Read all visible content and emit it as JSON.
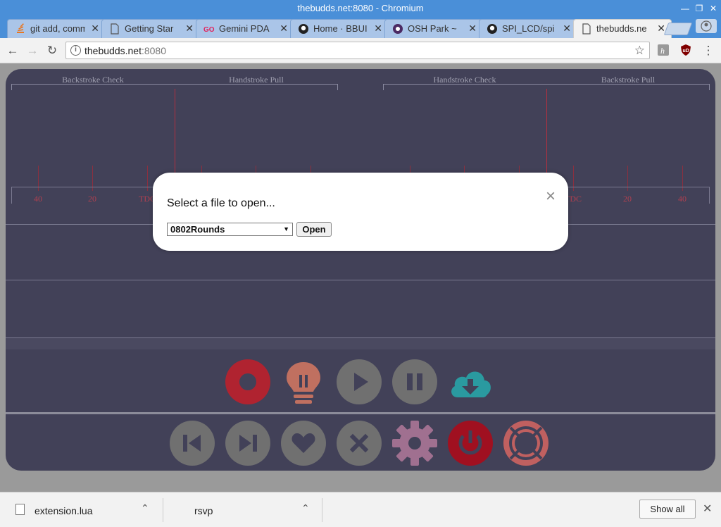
{
  "window": {
    "title": "thebudds.net:8080 - Chromium"
  },
  "tabs": [
    {
      "title": "git add, comm",
      "icon": "stackoverflow-icon"
    },
    {
      "title": "Getting Star",
      "icon": "document-icon"
    },
    {
      "title": "Gemini PDA",
      "icon": "go-icon"
    },
    {
      "title": "Home · BBUI",
      "icon": "github-icon"
    },
    {
      "title": "OSH Park ~",
      "icon": "oshpark-icon"
    },
    {
      "title": "SPI_LCD/spi",
      "icon": "github-icon"
    },
    {
      "title": "thebudds.ne",
      "icon": "document-icon"
    }
  ],
  "toolbar": {
    "url_host": "thebudds.net",
    "url_port": ":8080"
  },
  "graph": {
    "bracket_labels": [
      "Backstroke Check",
      "Handstroke Pull",
      "Handstroke Check",
      "Backstroke Pull"
    ],
    "scale_left": [
      "40",
      "20",
      "TDC"
    ],
    "scale_right": [
      "TDC",
      "20",
      "40"
    ]
  },
  "controls": {
    "row1": [
      "record-icon",
      "lightbulb-icon",
      "play-icon",
      "pause-icon",
      "cloud-download-icon"
    ],
    "row2": [
      "skip-previous-icon",
      "skip-next-icon",
      "heart-icon",
      "cross-icon",
      "gear-icon",
      "power-icon",
      "lifebuoy-icon"
    ]
  },
  "modal": {
    "title": "Select a file to open...",
    "selected_file": "0802Rounds",
    "open_label": "Open",
    "close_symbol": "×"
  },
  "downloads": {
    "items": [
      {
        "name": "extension.lua"
      },
      {
        "name": "rsvp"
      }
    ],
    "show_all_label": "Show all"
  },
  "colors": {
    "titlebar": "#4a8fd8",
    "panel": "#424158",
    "record": "#b02330",
    "bulb": "#c07060",
    "cloud": "#2a9aa0",
    "gear": "#a07090",
    "power": "#a01020",
    "lifebuoy": "#c06060",
    "gray_button": "#707070"
  }
}
